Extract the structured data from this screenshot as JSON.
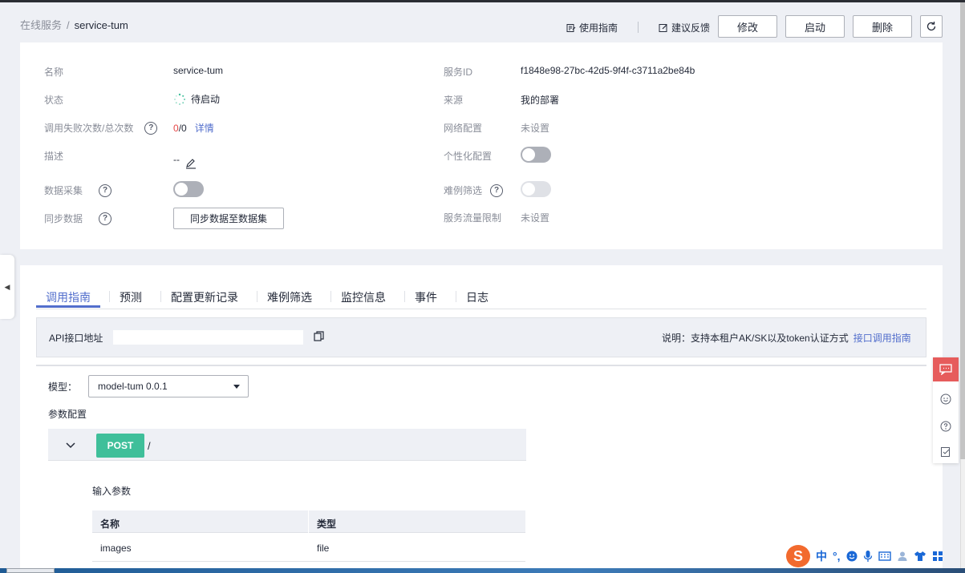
{
  "breadcrumb": {
    "parent": "在线服务",
    "separator": "/",
    "current": "service-tum"
  },
  "header": {
    "guide_label": "使用指南",
    "feedback_label": "建议反馈",
    "edit_button": "修改",
    "start_button": "启动",
    "delete_button": "删除"
  },
  "details": {
    "left": {
      "name_label": "名称",
      "name_value": "service-tum",
      "status_label": "状态",
      "status_value": "待启动",
      "calls_label": "调用失败次数/总次数",
      "calls_fail": "0",
      "calls_total": "/0",
      "calls_detail": "详情",
      "desc_label": "描述",
      "desc_value": "--",
      "collect_label": "数据采集",
      "collect_on": false,
      "sync_label": "同步数据",
      "sync_button": "同步数据至数据集"
    },
    "right": {
      "service_id_label": "服务ID",
      "service_id_value": "f1848e98-27bc-42d5-9f4f-c3711a2be84b",
      "source_label": "来源",
      "source_value": "我的部署",
      "network_label": "网络配置",
      "network_value": "未设置",
      "custom_label": "个性化配置",
      "custom_on": false,
      "hard_label": "难例筛选",
      "hard_on": false,
      "limit_label": "服务流量限制",
      "limit_value": "未设置"
    }
  },
  "tabs": [
    {
      "label": "调用指南",
      "active": true
    },
    {
      "label": "预测",
      "active": false
    },
    {
      "label": "配置更新记录",
      "active": false
    },
    {
      "label": "难例筛选",
      "active": false
    },
    {
      "label": "监控信息",
      "active": false
    },
    {
      "label": "事件",
      "active": false
    },
    {
      "label": "日志",
      "active": false
    }
  ],
  "api": {
    "label": "API接口地址",
    "url_value": "",
    "note": "说明：支持本租户AK/SK以及token认证方式",
    "guide_link": "接口调用指南"
  },
  "model": {
    "label": "模型：",
    "selected": "model-tum 0.0.1",
    "params_label": "参数配置"
  },
  "endpoint": {
    "method": "POST",
    "path": "/"
  },
  "input_params": {
    "title": "输入参数",
    "columns": [
      "名称",
      "类型"
    ],
    "rows": [
      [
        "images",
        "file"
      ]
    ]
  },
  "ime": {
    "logo": "S",
    "mode": "中",
    "punct": "°,"
  },
  "colors": {
    "accent": "#526ecc",
    "post": "#3fbf9a",
    "danger": "#e54545",
    "float": "#e65c5c"
  }
}
